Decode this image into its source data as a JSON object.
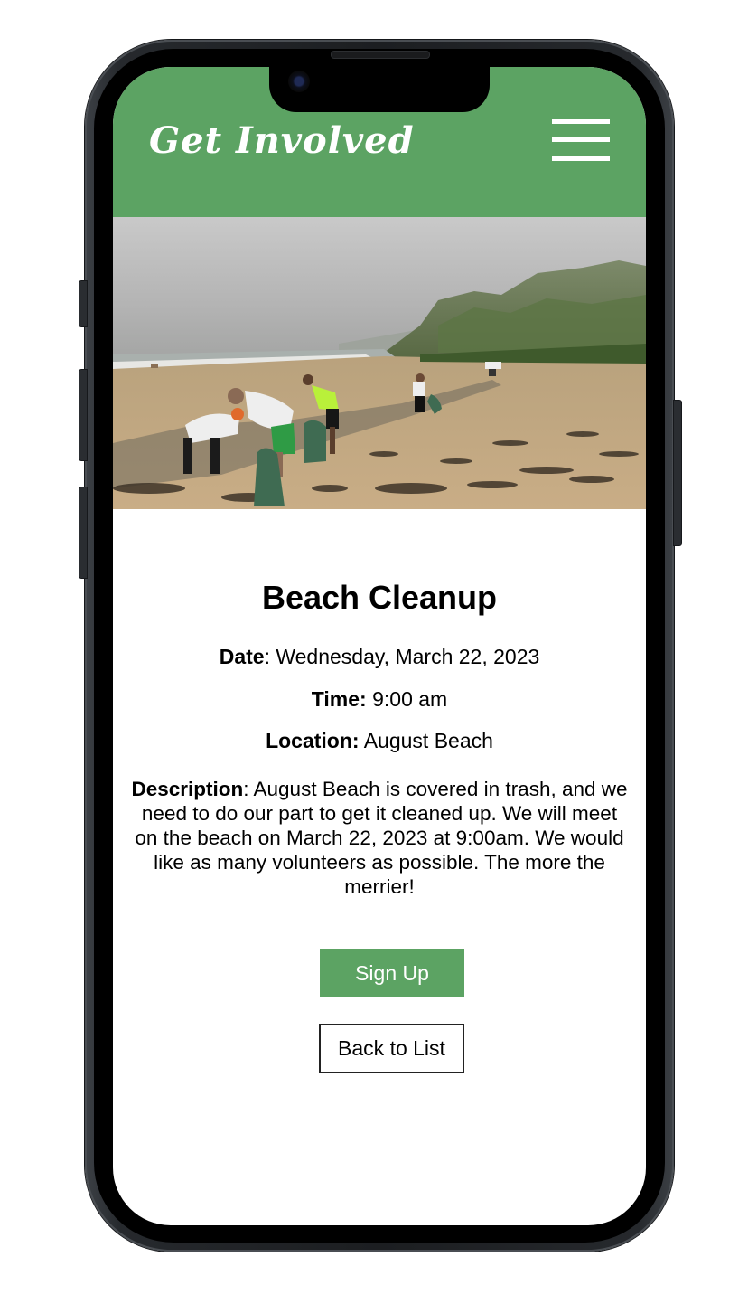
{
  "app": {
    "title": "Get Involved",
    "accent_color": "#5ca363",
    "menu_icon": "hamburger-menu-icon"
  },
  "hero_image": {
    "subject": "volunteers collecting trash on a sandy beach under a cloudy sky"
  },
  "event": {
    "title": "Beach Cleanup",
    "date_label": "Date",
    "date_value": ": Wednesday, March 22, 2023",
    "time_label": "Time:",
    "time_value": " 9:00 am",
    "location_label": "Location:",
    "location_value": " August Beach",
    "description_label": "Description",
    "description_value": ": August Beach is covered in trash, and we need to do our part to get it cleaned up. We will meet on the beach on March 22, 2023 at 9:00am. We would like as many volunteers as possible. The more the merrier!"
  },
  "actions": {
    "signup_label": "Sign Up",
    "back_label": "Back to List"
  }
}
